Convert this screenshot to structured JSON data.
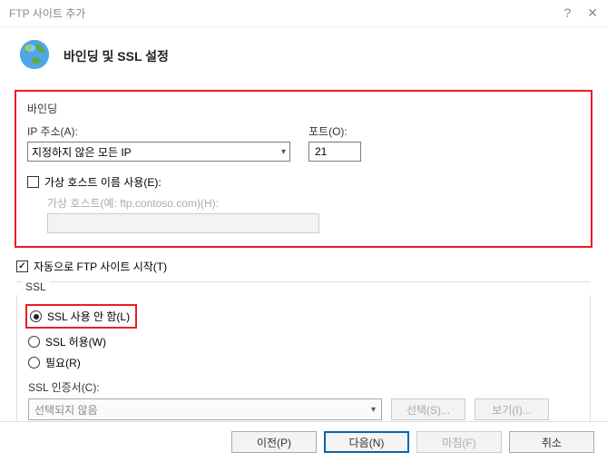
{
  "window": {
    "title": "FTP 사이트 추가"
  },
  "header": {
    "title": "바인딩 및 SSL 설정"
  },
  "binding": {
    "group_label": "바인딩",
    "ip_label": "IP 주소(A):",
    "ip_value": "지정하지 않은 모든 IP",
    "port_label": "포트(O):",
    "port_value": "21",
    "virtual_host_checkbox_label": "가상 호스트 이름 사용(E):",
    "virtual_host_label": "가상 호스트(예: ftp.contoso.com)(H):",
    "virtual_host_value": ""
  },
  "auto_start": {
    "label": "자동으로 FTP 사이트 시작(T)"
  },
  "ssl": {
    "group_label": "SSL",
    "option_none": "SSL 사용 안 함(L)",
    "option_allow": "SSL 허용(W)",
    "option_require": "필요(R)",
    "cert_label": "SSL 인증서(C):",
    "cert_value": "선택되지 않음",
    "select_btn": "선택(S)...",
    "view_btn": "보기(I)..."
  },
  "buttons": {
    "prev": "이전(P)",
    "next": "다음(N)",
    "finish": "마침(F)",
    "cancel": "취소"
  }
}
